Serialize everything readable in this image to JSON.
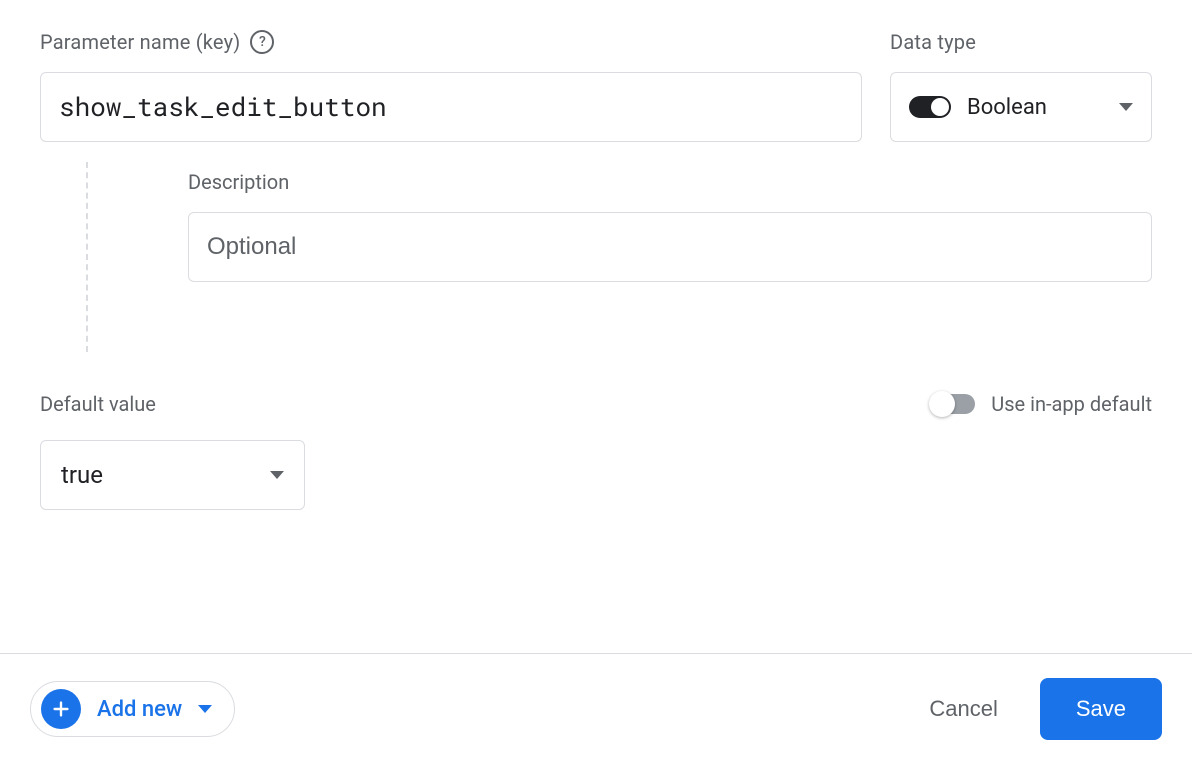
{
  "parameter_name": {
    "label": "Parameter name (key)",
    "value": "show_task_edit_button"
  },
  "data_type": {
    "label": "Data type",
    "value": "Boolean"
  },
  "description": {
    "label": "Description",
    "placeholder": "Optional",
    "value": ""
  },
  "default_value": {
    "label": "Default value",
    "value": "true"
  },
  "in_app_default": {
    "label": "Use in-app default",
    "on": false
  },
  "footer": {
    "add_new_label": "Add new",
    "cancel_label": "Cancel",
    "save_label": "Save"
  },
  "help_icon_char": "?"
}
